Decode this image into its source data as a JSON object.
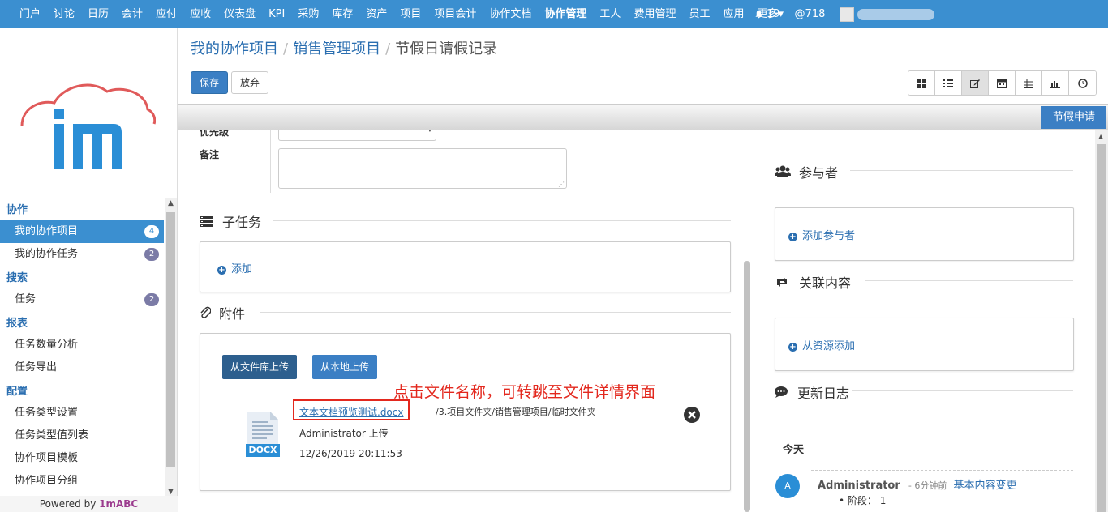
{
  "topnav": {
    "items": [
      "门户",
      "讨论",
      "日历",
      "会计",
      "应付",
      "应收",
      "仪表盘",
      "KPI",
      "采购",
      "库存",
      "资产",
      "项目",
      "项目会计",
      "协作文档",
      "协作管理",
      "工人",
      "费用管理",
      "员工",
      "应用",
      "更多▾"
    ],
    "active_index": 14,
    "notifications": "19",
    "mentions": "@718"
  },
  "sidebar": {
    "groups": [
      {
        "label": "协作",
        "items": [
          {
            "label": "我的协作项目",
            "badge": "4",
            "active": true
          },
          {
            "label": "我的协作任务",
            "badge": "2"
          }
        ]
      },
      {
        "label": "搜索",
        "items": [
          {
            "label": "任务",
            "badge": "2"
          }
        ]
      },
      {
        "label": "报表",
        "items": [
          {
            "label": "任务数量分析"
          },
          {
            "label": "任务导出"
          }
        ]
      },
      {
        "label": "配置",
        "items": [
          {
            "label": "任务类型设置"
          },
          {
            "label": "任务类型值列表"
          },
          {
            "label": "协作项目模板"
          },
          {
            "label": "协作项目分组"
          }
        ]
      }
    ],
    "powered_prefix": "Powered by ",
    "powered_brand": "1mABC"
  },
  "breadcrumb": {
    "first": "我的协作项目",
    "second": "销售管理项目",
    "last": "节假日请假记录"
  },
  "toolbar": {
    "save": "保存",
    "discard": "放弃"
  },
  "tab": {
    "leave_request": "节假申请"
  },
  "form": {
    "priority_label": "优先级",
    "note_label": "备注"
  },
  "subtasks": {
    "title": "子任务",
    "add": "添加"
  },
  "attachments": {
    "title": "附件",
    "upload_library": "从文件库上传",
    "upload_local": "从本地上传",
    "file_name": "文本文档预览测试.docx",
    "file_path": "/3.项目文件夹/销售管理项目/临时文件夹",
    "uploader": "Administrator 上传",
    "uploaded_at": "12/26/2019 20:11:53",
    "file_type": "DOCX",
    "annotation": "点击文件名称，可转跳至文件详情界面"
  },
  "participants": {
    "title": "参与者",
    "add": "添加参与者"
  },
  "related": {
    "title": "关联内容",
    "add": "从资源添加"
  },
  "updates": {
    "title": "更新日志",
    "today": "今天",
    "author_initial": "A",
    "author": "Administrator",
    "time": "- 6分钟前",
    "action": "基本内容变更",
    "entry_label": "阶段：",
    "entry_value": "1"
  },
  "colors": {
    "nav": "#3b8fd0",
    "primary": "#3b7fc4",
    "annotation": "#e3281e"
  }
}
